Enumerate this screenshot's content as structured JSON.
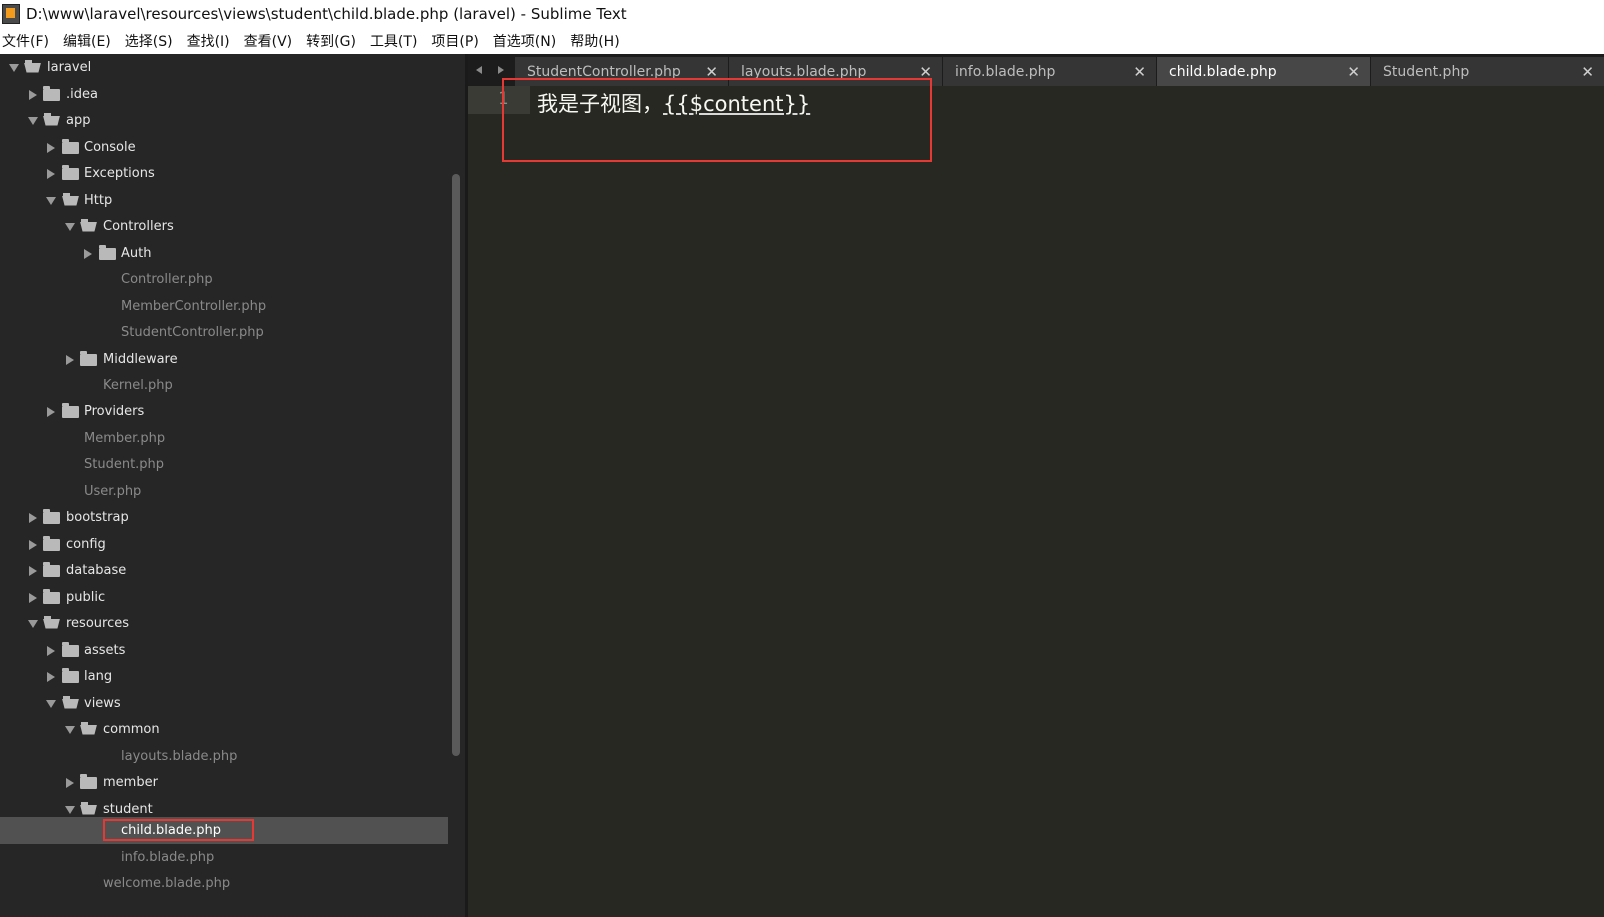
{
  "window": {
    "title": "D:\\www\\laravel\\resources\\views\\student\\child.blade.php (laravel) - Sublime Text"
  },
  "menu": [
    "文件(F)",
    "编辑(E)",
    "选择(S)",
    "查找(I)",
    "查看(V)",
    "转到(G)",
    "工具(T)",
    "项目(P)",
    "首选项(N)",
    "帮助(H)"
  ],
  "sidebar": {
    "items": [
      {
        "label": "laravel",
        "type": "folder",
        "expanded": true
      },
      {
        "label": ".idea",
        "type": "folder",
        "expanded": false
      },
      {
        "label": "app",
        "type": "folder",
        "expanded": true
      },
      {
        "label": "Console",
        "type": "folder",
        "expanded": false
      },
      {
        "label": "Exceptions",
        "type": "folder",
        "expanded": false
      },
      {
        "label": "Http",
        "type": "folder",
        "expanded": true
      },
      {
        "label": "Controllers",
        "type": "folder",
        "expanded": true
      },
      {
        "label": "Auth",
        "type": "folder",
        "expanded": false
      },
      {
        "label": "Controller.php",
        "type": "file"
      },
      {
        "label": "MemberController.php",
        "type": "file"
      },
      {
        "label": "StudentController.php",
        "type": "file"
      },
      {
        "label": "Middleware",
        "type": "folder",
        "expanded": false
      },
      {
        "label": "Kernel.php",
        "type": "file"
      },
      {
        "label": "Providers",
        "type": "folder",
        "expanded": false
      },
      {
        "label": "Member.php",
        "type": "file"
      },
      {
        "label": "Student.php",
        "type": "file"
      },
      {
        "label": "User.php",
        "type": "file"
      },
      {
        "label": "bootstrap",
        "type": "folder",
        "expanded": false
      },
      {
        "label": "config",
        "type": "folder",
        "expanded": false
      },
      {
        "label": "database",
        "type": "folder",
        "expanded": false
      },
      {
        "label": "public",
        "type": "folder",
        "expanded": false
      },
      {
        "label": "resources",
        "type": "folder",
        "expanded": true
      },
      {
        "label": "assets",
        "type": "folder",
        "expanded": false
      },
      {
        "label": "lang",
        "type": "folder",
        "expanded": false
      },
      {
        "label": "views",
        "type": "folder",
        "expanded": true
      },
      {
        "label": "common",
        "type": "folder",
        "expanded": true
      },
      {
        "label": "layouts.blade.php",
        "type": "file"
      },
      {
        "label": "member",
        "type": "folder",
        "expanded": false
      },
      {
        "label": "student",
        "type": "folder",
        "expanded": true
      },
      {
        "label": "child.blade.php",
        "type": "file",
        "selected": true
      },
      {
        "label": "info.blade.php",
        "type": "file"
      },
      {
        "label": "welcome.blade.php",
        "type": "file"
      }
    ]
  },
  "tabs": [
    {
      "label": "StudentController.php",
      "active": false
    },
    {
      "label": "layouts.blade.php",
      "active": false
    },
    {
      "label": "info.blade.php",
      "active": false
    },
    {
      "label": "child.blade.php",
      "active": true
    },
    {
      "label": "Student.php",
      "active": false
    }
  ],
  "editor": {
    "line_number": "1",
    "code_text": "我是子视图，",
    "code_var": "{{$content}}"
  },
  "colors": {
    "sidebar_bg": "#262626",
    "editor_bg": "#272822",
    "highlight_red": "#e53935",
    "selected_row": "#515151"
  },
  "icons": {
    "app": "sublime-text-icon",
    "tab_close": "close-icon",
    "tab_nav_left": "chevron-left-icon",
    "tab_nav_right": "chevron-right-icon",
    "folder": "folder-icon",
    "folder_open": "folder-open-icon",
    "expand": "disclosure-triangle-icon"
  }
}
